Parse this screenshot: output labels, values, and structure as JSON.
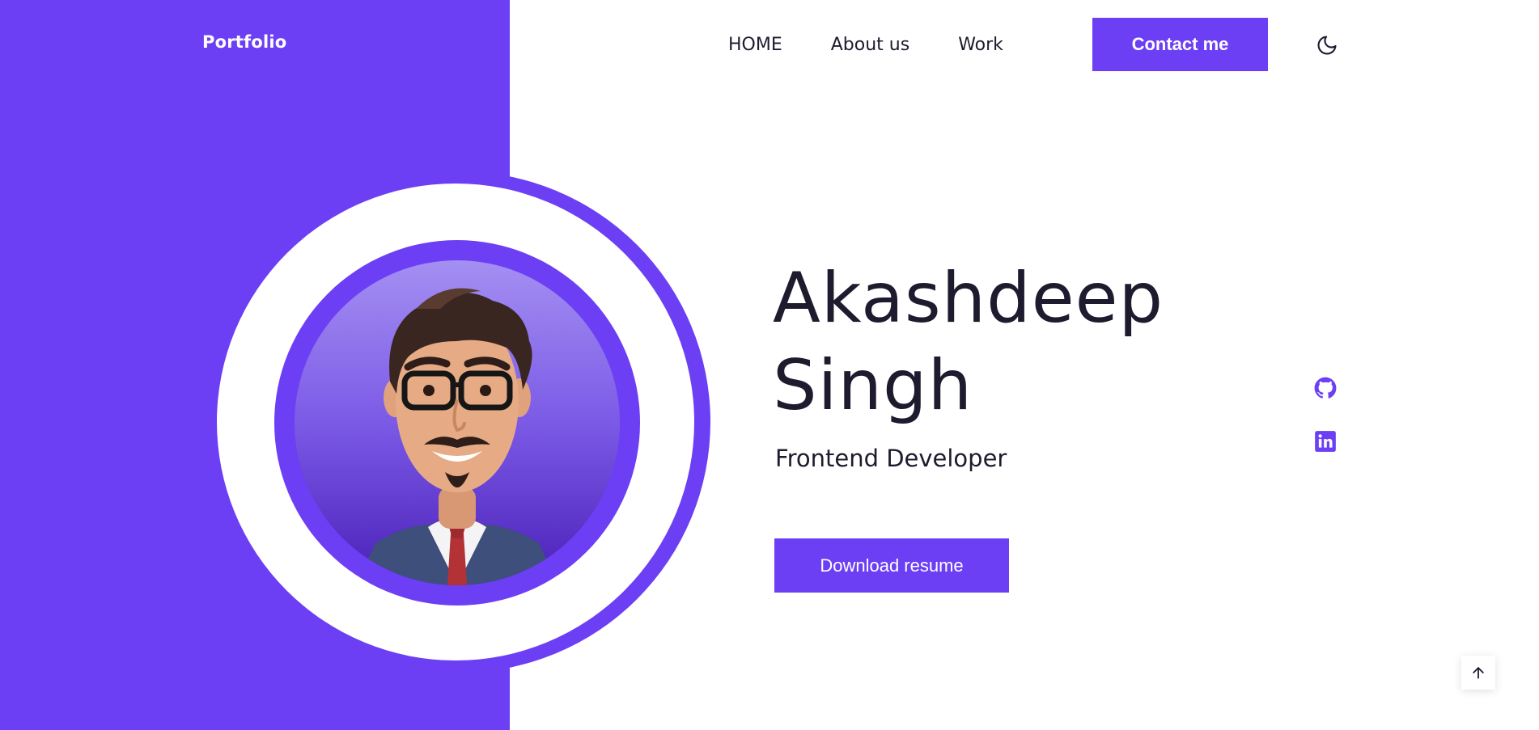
{
  "header": {
    "logo": "Portfolio",
    "nav": [
      "HOME",
      "About us",
      "Work"
    ],
    "contact_label": "Contact me",
    "theme_icon": "moon-icon"
  },
  "hero": {
    "name_line1": "Akashdeep",
    "name_line2": "Singh",
    "role": "Frontend Developer",
    "download_label": "Download resume",
    "avatar": "cartoon-avatar-image"
  },
  "social": {
    "icons": [
      "github-icon",
      "linkedin-icon"
    ]
  },
  "scroll_top": {
    "icon": "arrow-up-icon"
  },
  "colors": {
    "accent": "#6c3ff5",
    "text": "#1f1b2e",
    "background": "#ffffff"
  }
}
